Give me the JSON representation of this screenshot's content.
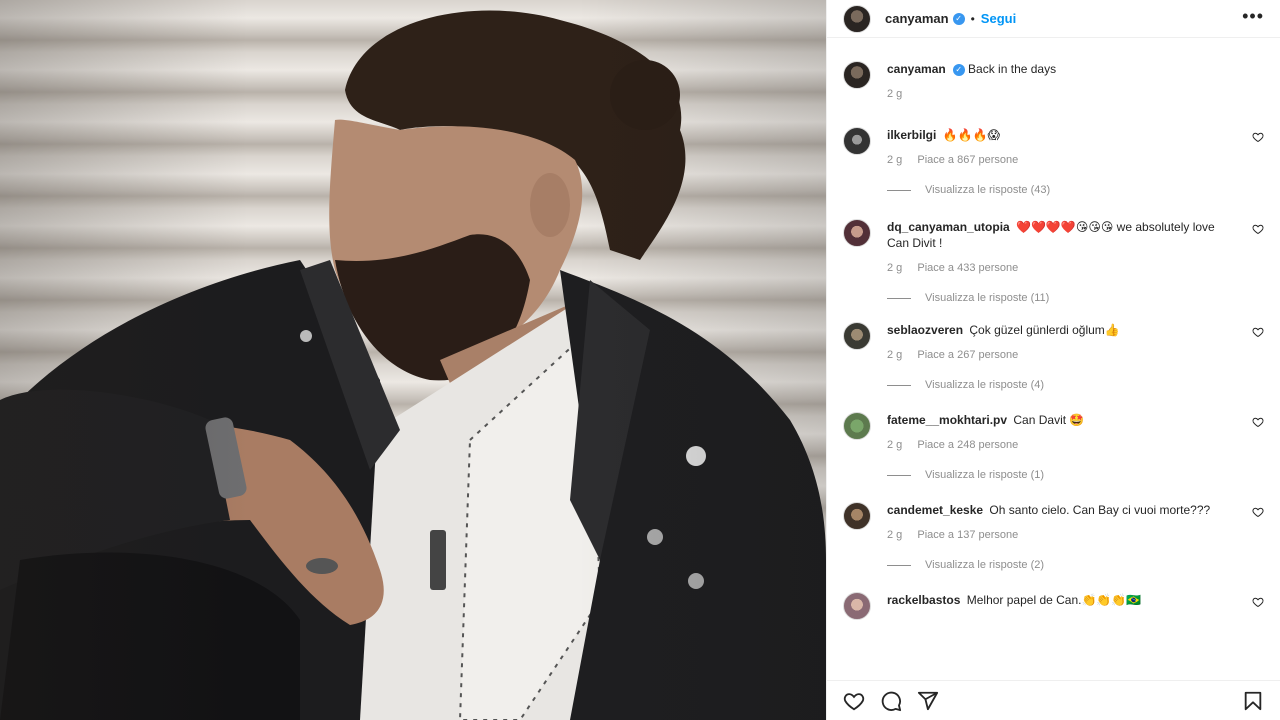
{
  "post": {
    "author": "canyaman",
    "follow_label": "Segui",
    "dot": "•",
    "more_label": "•••"
  },
  "caption": {
    "username": "canyaman",
    "text": "Back in the days",
    "time": "2 g"
  },
  "comments": [
    {
      "username": "ilkerbilgi",
      "text": "🔥🔥🔥😱",
      "time": "2 g",
      "likes": "Piace a 867 persone",
      "replies": "Visualizza le risposte (43)"
    },
    {
      "username": "dq_canyaman_utopia",
      "text": "❤️❤️❤️❤️😘😘😘 we absolutely love Can Divit !",
      "time": "2 g",
      "likes": "Piace a 433 persone",
      "replies": "Visualizza le risposte (11)"
    },
    {
      "username": "seblaozveren",
      "text": "Çok güzel günlerdi oğlum👍",
      "time": "2 g",
      "likes": "Piace a 267 persone",
      "replies": "Visualizza le risposte (4)"
    },
    {
      "username": "fateme__mokhtari.pv",
      "text": "Can Davit 🤩",
      "time": "2 g",
      "likes": "Piace a 248 persone",
      "replies": "Visualizza le risposte (1)"
    },
    {
      "username": "candemet_keske",
      "text": "Oh santo cielo. Can Bay ci vuoi morte???",
      "time": "2 g",
      "likes": "Piace a 137 persone",
      "replies": "Visualizza le risposte (2)"
    },
    {
      "username": "rackelbastos",
      "text": "Melhor papel de Can.👏👏👏🇧🇷"
    }
  ],
  "icons": {
    "like": "heart-icon",
    "comment": "comment-icon",
    "share": "send-icon",
    "save": "bookmark-icon",
    "verified": "verified-badge-icon"
  },
  "colors": {
    "link": "#0095f6",
    "verified": "#3897f0",
    "muted": "#8e8e8e"
  }
}
